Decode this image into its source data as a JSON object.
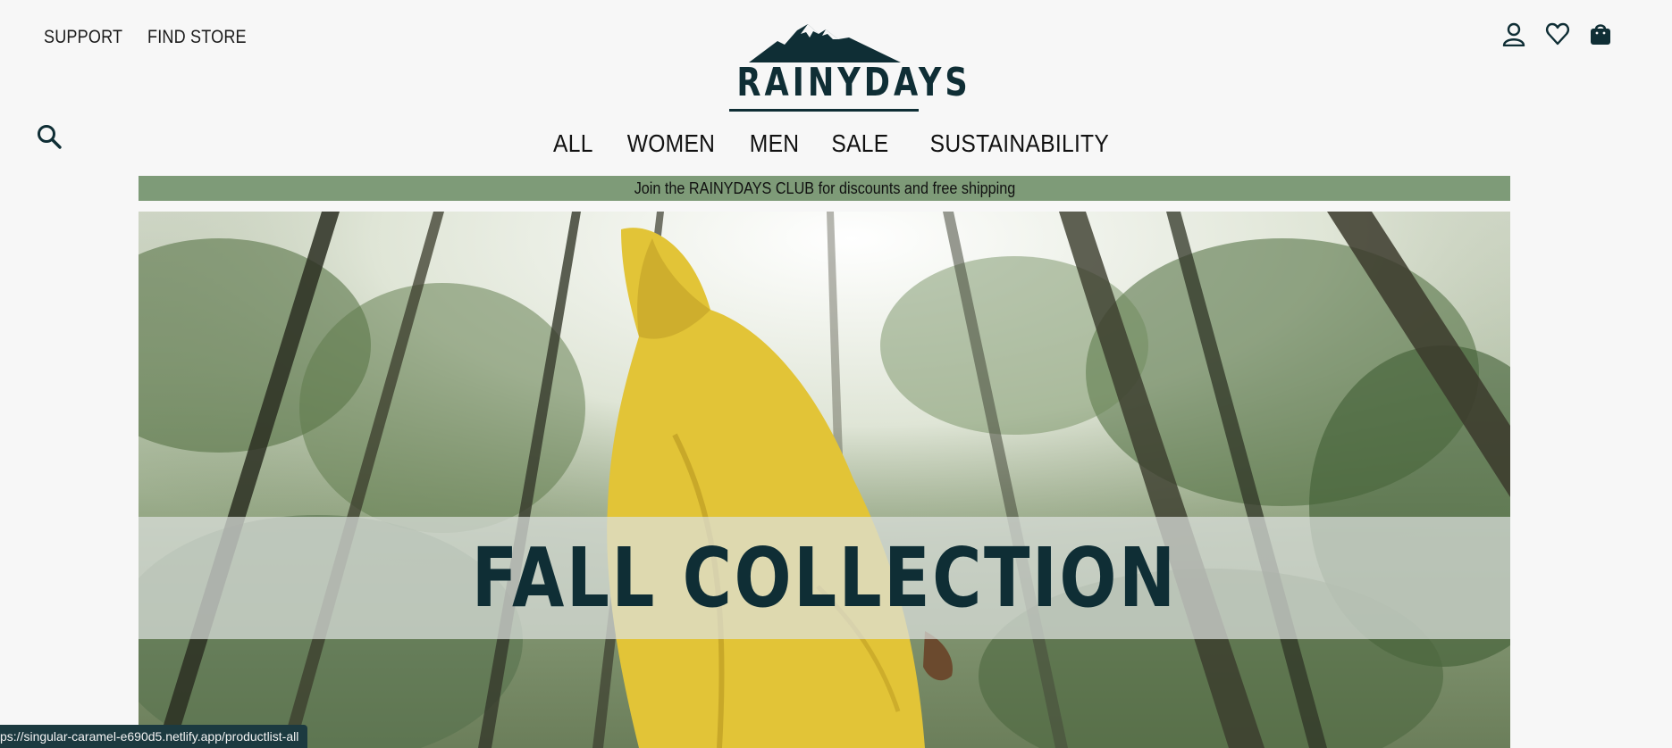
{
  "header": {
    "top_links": [
      {
        "label": "SUPPORT"
      },
      {
        "label": "FIND STORE"
      }
    ],
    "logo_text": "RAINYDAYS",
    "icons": [
      "user-icon",
      "heart-icon",
      "shopping-bag-icon"
    ],
    "search_icon": "search-icon"
  },
  "nav": {
    "items": [
      {
        "label": "ALL"
      },
      {
        "label": "WOMEN"
      },
      {
        "label": "MEN"
      },
      {
        "label": "SALE"
      },
      {
        "label": "SUSTAINABILITY"
      }
    ]
  },
  "promo_banner": {
    "text": "Join the RAINYDAYS CLUB for discounts and free shipping",
    "background": "#7e9b78"
  },
  "hero": {
    "title": "FALL COLLECTION",
    "title_color": "#0f2e35",
    "raincoat_color": "#e2c437"
  },
  "status_bar": {
    "url": "ps://singular-caramel-e690d5.netlify.app/productlist-all"
  },
  "colors": {
    "brand": "#0f2e35",
    "page_background": "#f7f7f7"
  }
}
